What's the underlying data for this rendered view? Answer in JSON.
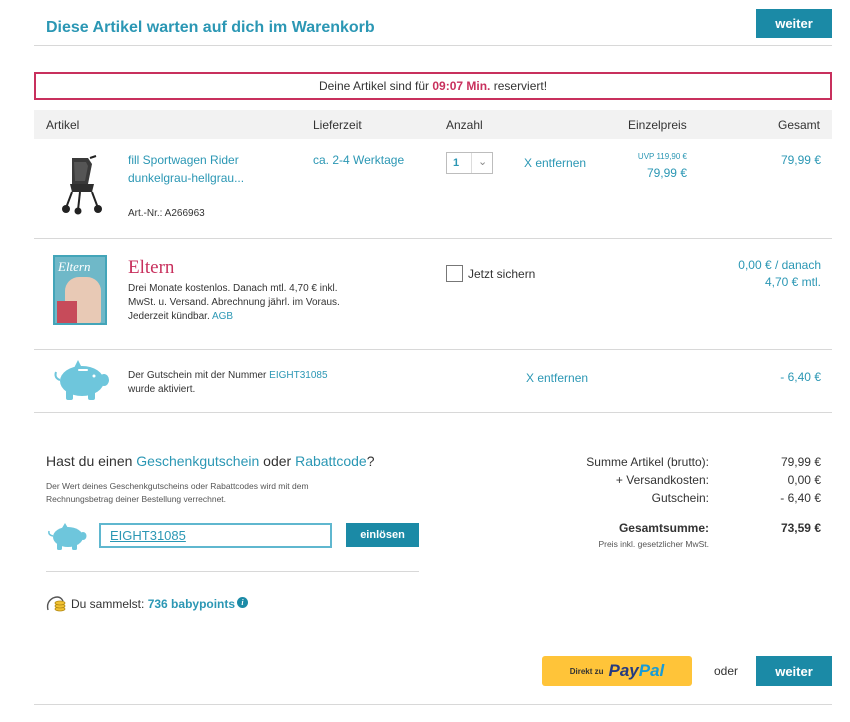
{
  "header": {
    "title": "Diese Artikel warten auf dich im Warenkorb",
    "continue_label": "weiter"
  },
  "reservation": {
    "prefix": "Deine Artikel sind für",
    "time": "09:07 Min.",
    "suffix": "reserviert!"
  },
  "table_headers": {
    "article": "Artikel",
    "delivery": "Lieferzeit",
    "quantity": "Anzahl",
    "unit_price": "Einzelpreis",
    "total": "Gesamt"
  },
  "product": {
    "name_line1": "fill Sportwagen Rider",
    "name_line2": "dunkelgrau-hellgrau...",
    "sku": "Art.-Nr.: A266963",
    "delivery": "ca. 2-4 Werktage",
    "quantity": "1",
    "remove_label": "X entfernen",
    "uvp": "UVP  119,90 €",
    "unit_price": "79,99 €",
    "total": "79,99 €"
  },
  "magazine": {
    "cover_title": "Eltern",
    "logo": "Eltern",
    "desc_line1": "Drei Monate kostenlos. Danach mtl. 4,70 € inkl.",
    "desc_line2": "MwSt. u. Versand. Abrechnung jährl. im Voraus.",
    "desc_line3": "Jederzeit kündbar.",
    "agb": "AGB",
    "checkbox_label": "Jetzt sichern",
    "price_line1": "0,00 € / danach",
    "price_line2": "4,70 € mtl."
  },
  "voucher_row": {
    "text_prefix": "Der Gutschein mit der Nummer",
    "code": "EIGHT31085",
    "text_line2": "wurde aktiviert.",
    "remove_label": "X entfernen",
    "amount": "- 6,40 €"
  },
  "coupon": {
    "q_prefix": "Hast du einen",
    "gift_link": "Geschenkgutschein",
    "q_middle": "oder",
    "code_link": "Rabattcode",
    "q_suffix": "?",
    "info_line1": "Der Wert deines Geschenkgutscheins oder Rabattcodes wird mit dem",
    "info_line2": "Rechnungsbetrag deiner Bestellung verrechnet.",
    "input_value": "EIGHT31085",
    "redeem_label": "einlösen"
  },
  "points": {
    "prefix": "Du sammelst:",
    "value": "736 babypoints"
  },
  "summary": {
    "items_label": "Summe Artikel (brutto):",
    "items_value": "79,99 €",
    "shipping_label": "+ Versandkosten:",
    "shipping_value": "0,00 €",
    "voucher_label": "Gutschein:",
    "voucher_value": "- 6,40 €",
    "total_label": "Gesamtsumme:",
    "total_value": "73,59 €",
    "tax_note": "Preis inkl. gesetzlicher MwSt."
  },
  "footer": {
    "paypal_prefix": "Direkt zu",
    "paypal_pay": "Pay",
    "paypal_pal": "Pal",
    "or_label": "oder",
    "continue_label": "weiter"
  },
  "colors": {
    "accent": "#1b8aa6",
    "link": "#2b97b4",
    "reservation_border": "#c8305d",
    "paypal_yellow": "#ffc439"
  }
}
